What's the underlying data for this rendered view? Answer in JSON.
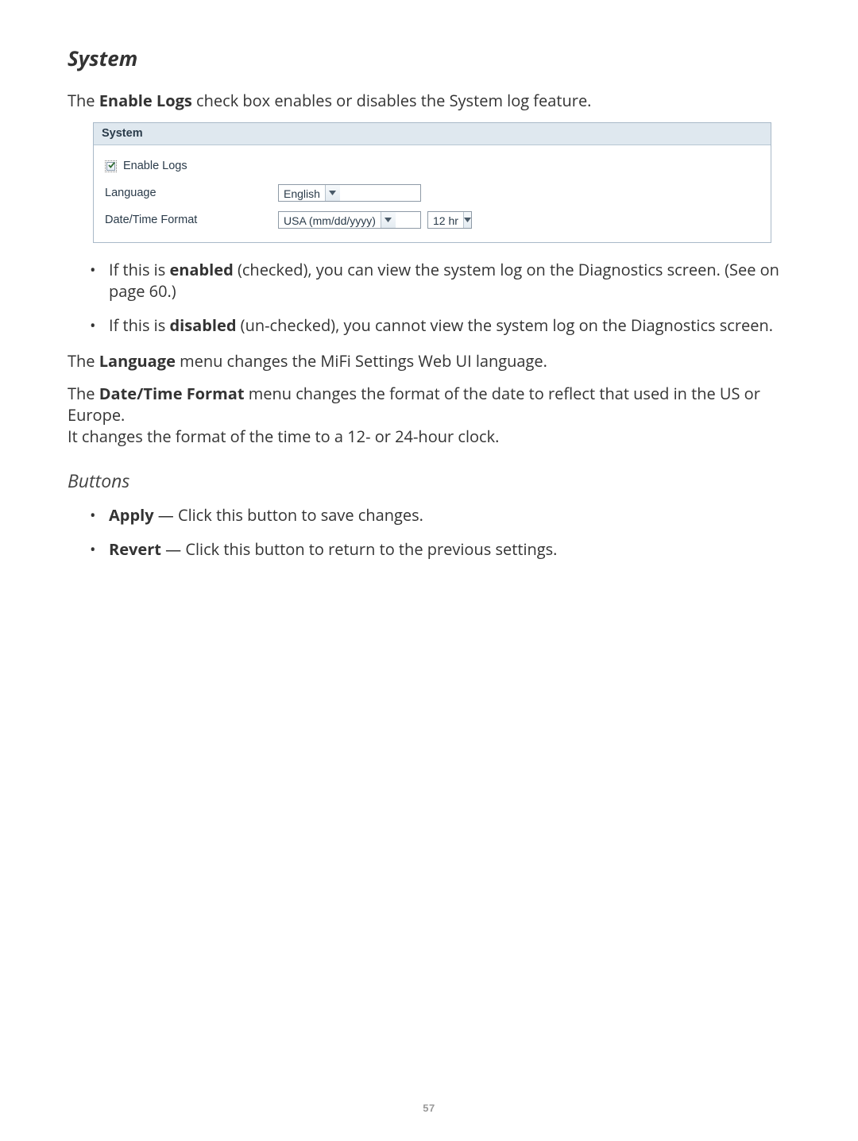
{
  "section_title": "System",
  "intro": {
    "pre": "The ",
    "bold": "Enable Logs",
    "post": " check box enables or disables the System log feature."
  },
  "panel": {
    "title": "System",
    "enable_logs_label": "Enable Logs",
    "language_label": "Language",
    "language_value": "English",
    "datetime_label": "Date/Time Format",
    "date_value": "USA (mm/dd/yyyy)",
    "clock_value": "12 hr"
  },
  "bullets_top": [
    {
      "pre": "If this is ",
      "bold": "enabled",
      "post1": " (checked), you can view the system log on the Diagnostics screen. (See  on",
      "post2": "page 60.)"
    },
    {
      "pre": "If this is ",
      "bold": "disabled",
      "post1": " (un-checked), you cannot view the system log on the Diagnostics screen.",
      "post2": ""
    }
  ],
  "para_language": {
    "pre": "The ",
    "bold": "Language",
    "post": " menu changes the MiFi Settings Web UI language."
  },
  "para_datetime": {
    "pre": "The ",
    "bold": "Date/Time Format",
    "post1": " menu changes the format of the date to reflect that used in the US or Europe.",
    "post2": "It changes the format of the time to a 12- or 24-hour clock."
  },
  "buttons_title": "Buttons",
  "bullets_buttons": [
    {
      "bold": "Apply",
      "post": " — Click this button to save changes."
    },
    {
      "bold": "Revert",
      "post": " — Click this button to return to the previous settings."
    }
  ],
  "page_number": "57"
}
